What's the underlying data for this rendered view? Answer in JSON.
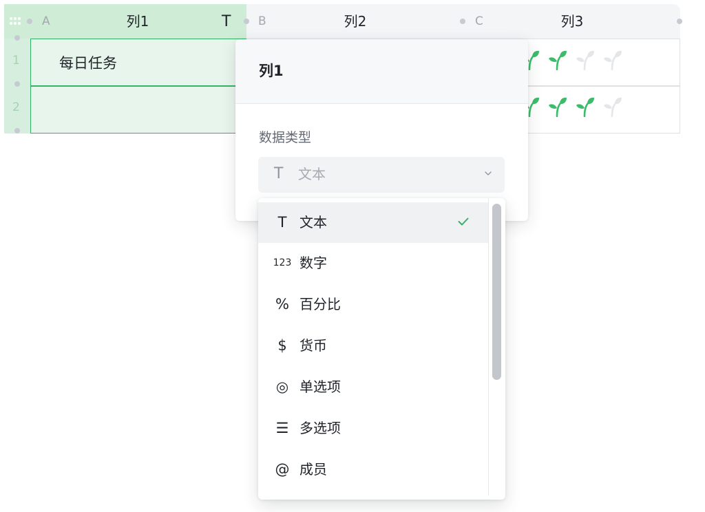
{
  "sheet": {
    "columns": [
      {
        "letter": "A",
        "name": "列1",
        "type_icon": "T"
      },
      {
        "letter": "B",
        "name": "列2"
      },
      {
        "letter": "C",
        "name": "列3"
      }
    ],
    "rows": [
      {
        "num": "1",
        "a": "每日任务",
        "rating": 2
      },
      {
        "num": "2",
        "a": "",
        "rating": 3
      }
    ],
    "rating_max": 4,
    "rating_icon": "sprout-icon"
  },
  "popover": {
    "title": "列1",
    "type_label": "数据类型",
    "select": {
      "icon": "T",
      "value": "文本"
    }
  },
  "dropdown": {
    "selected_index": 0,
    "options": [
      {
        "icon": "T",
        "label": "文本"
      },
      {
        "icon": "123",
        "label": "数字"
      },
      {
        "icon": "%",
        "label": "百分比"
      },
      {
        "icon": "$",
        "label": "货币"
      },
      {
        "icon": "◎",
        "label": "单选项"
      },
      {
        "icon": "☰",
        "label": "多选项"
      },
      {
        "icon": "@",
        "label": "成员"
      }
    ]
  },
  "colors": {
    "accent": "#34b263",
    "selected_header": "#cfecd7",
    "leaf": "#3dbb6b",
    "leaf_empty": "#e4e6ea"
  }
}
